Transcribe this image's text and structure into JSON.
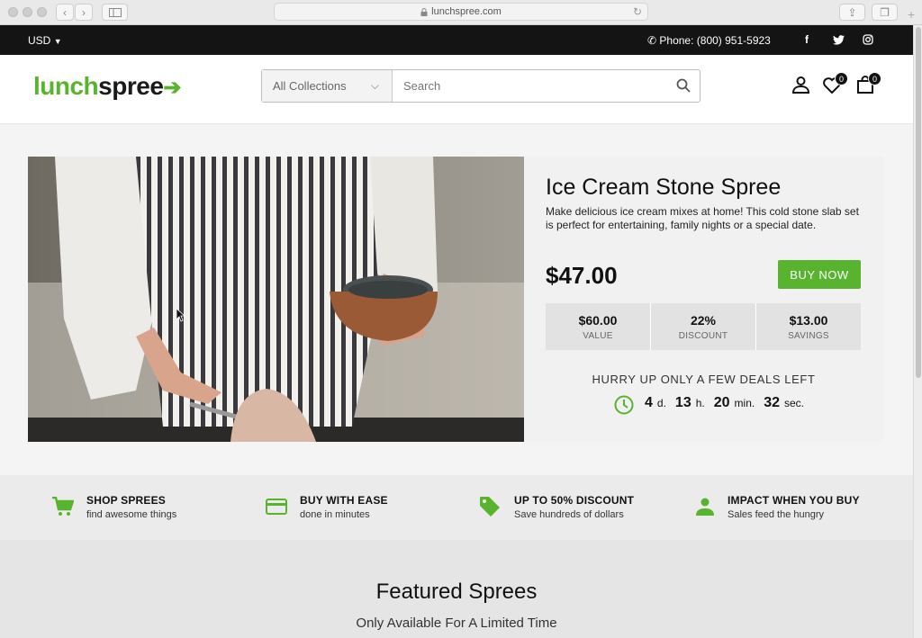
{
  "browser": {
    "url": "lunchspree.com"
  },
  "topbar": {
    "currency": "USD",
    "phone": "Phone: (800) 951-5923",
    "social": [
      "facebook-icon",
      "twitter-icon",
      "instagram-icon"
    ]
  },
  "header": {
    "logo_a": "lunch",
    "logo_b": "spree",
    "collections": "All Collections",
    "search_placeholder": "Search",
    "wishlist_count": "0",
    "cart_count": "0"
  },
  "product": {
    "title": "Ice Cream Stone Spree",
    "description": "Make delicious ice cream mixes at home! This cold stone slab set is perfect for entertaining, family nights or a special date.",
    "price": "$47.00",
    "buy_label": "BUY NOW",
    "stats": [
      {
        "value": "$60.00",
        "label": "VALUE"
      },
      {
        "value": "22%",
        "label": "DISCOUNT"
      },
      {
        "value": "$13.00",
        "label": "SAVINGS"
      }
    ],
    "hurry": "HURRY UP ONLY A FEW DEALS LEFT",
    "countdown": {
      "d": "4",
      "d_unit": "d.",
      "h": "13",
      "h_unit": "h.",
      "m": "20",
      "m_unit": "min.",
      "s": "32",
      "s_unit": "sec."
    }
  },
  "features": [
    {
      "title": "SHOP SPREES",
      "sub": "find awesome things",
      "icon": "cart-icon"
    },
    {
      "title": "BUY WITH EASE",
      "sub": "done in minutes",
      "icon": "credit-card-icon"
    },
    {
      "title": "UP TO 50% DISCOUNT",
      "sub": "Save hundreds of dollars",
      "icon": "tag-icon"
    },
    {
      "title": "IMPACT WHEN YOU BUY",
      "sub": "Sales feed the hungry",
      "icon": "person-icon"
    }
  ],
  "featured": {
    "title": "Featured Sprees",
    "subtitle": "Only Available For A Limited Time"
  },
  "colors": {
    "accent": "#58b42f",
    "topbar": "#141414"
  }
}
